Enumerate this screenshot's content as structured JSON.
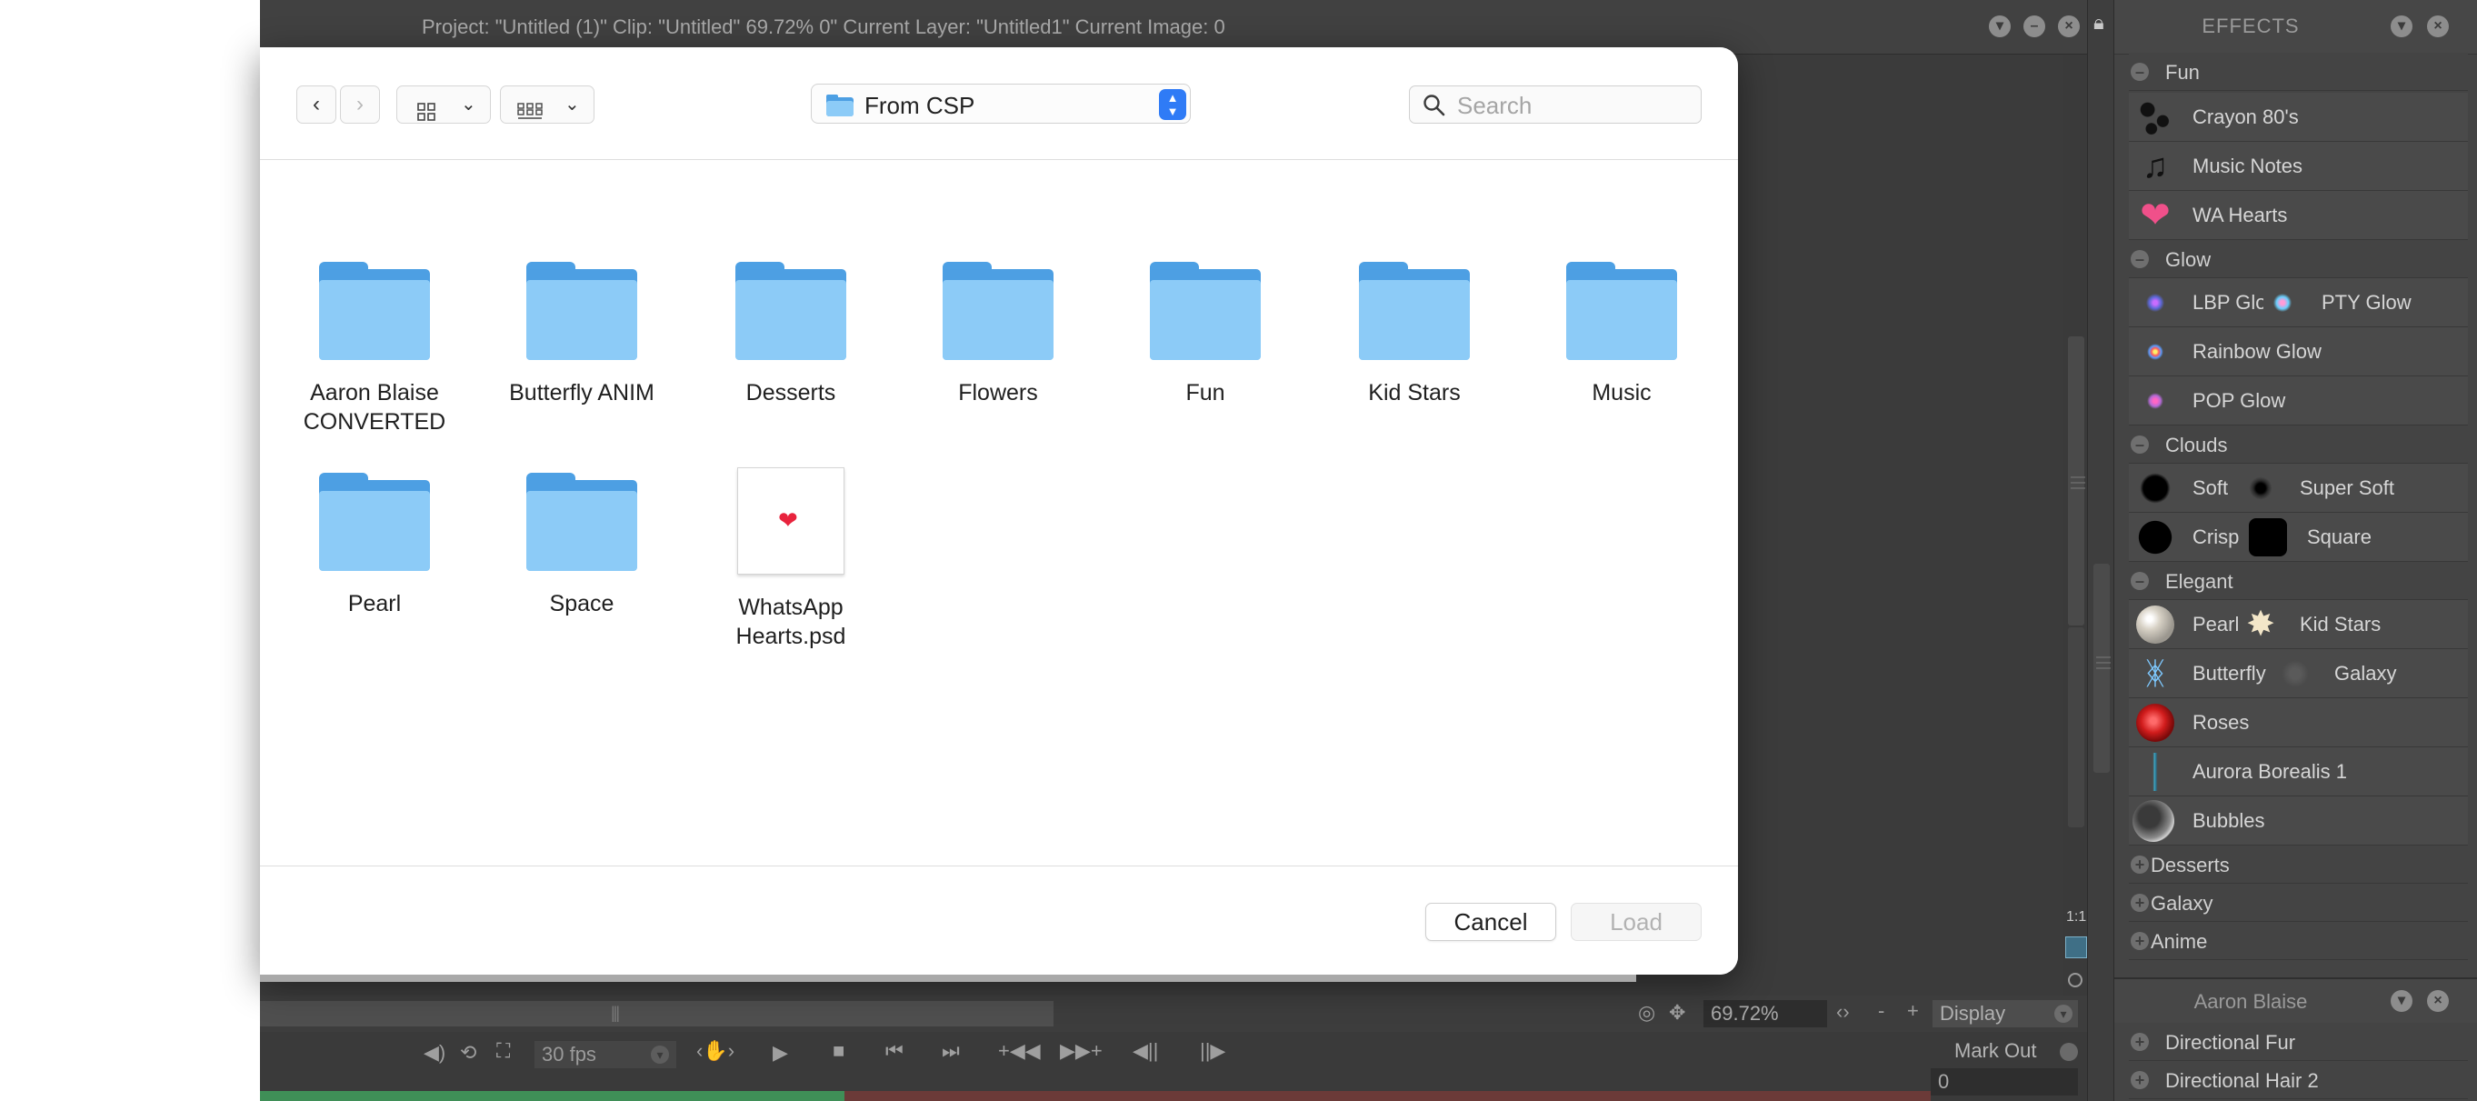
{
  "app": {
    "title_info": "Project:  \"Untitled (1)\"  Clip: \"Untitled\"   69.72%   0\"   Current Layer: \"Untitled1\"  Current Image: 0",
    "zoom": "69.72%",
    "display_label": "Display",
    "fps": "30 fps",
    "mark_out_label": "Mark Out",
    "frame": "0",
    "timeline_played_fraction": 0.35
  },
  "effects": {
    "title": "EFFECTS",
    "groups": [
      {
        "label": "Fun",
        "expanded": true,
        "items": [
          [
            "Crayon 80's"
          ],
          [
            "Music Notes"
          ],
          [
            "WA Hearts"
          ]
        ]
      },
      {
        "label": "Glow",
        "expanded": true,
        "items": [
          [
            "LBP Glow",
            "PTY Glow"
          ],
          [
            "Rainbow Glow"
          ],
          [
            "POP Glow"
          ]
        ]
      },
      {
        "label": "Clouds",
        "expanded": true,
        "items": [
          [
            "Soft",
            "Super Soft"
          ],
          [
            "Crisp",
            "Square"
          ]
        ]
      },
      {
        "label": "Elegant",
        "expanded": true,
        "items": [
          [
            "Pearl",
            "Kid Stars"
          ],
          [
            "Butterfly",
            "Galaxy"
          ],
          [
            "Roses"
          ],
          [
            "Aurora Borealis 1"
          ],
          [
            "Bubbles"
          ]
        ]
      },
      {
        "label": "Desserts",
        "expanded": false,
        "items": []
      },
      {
        "label": "Galaxy",
        "expanded": false,
        "items": []
      },
      {
        "label": "Anime",
        "expanded": false,
        "items": []
      }
    ]
  },
  "aaron_panel": {
    "title": "Aaron Blaise",
    "items": [
      "Directional Fur",
      "Directional Hair 2"
    ]
  },
  "dialog": {
    "location": "From CSP",
    "search_placeholder": "Search",
    "files": [
      {
        "name": "Aaron Blaise CONVERTED",
        "kind": "folder"
      },
      {
        "name": "Butterfly ANIM",
        "kind": "folder"
      },
      {
        "name": "Desserts",
        "kind": "folder"
      },
      {
        "name": "Flowers",
        "kind": "folder"
      },
      {
        "name": "Fun",
        "kind": "folder"
      },
      {
        "name": "Kid Stars",
        "kind": "folder"
      },
      {
        "name": "Music",
        "kind": "folder"
      },
      {
        "name": "Pearl",
        "kind": "folder"
      },
      {
        "name": "Space",
        "kind": "folder"
      },
      {
        "name": "WhatsApp Hearts.psd",
        "kind": "psd"
      }
    ],
    "cancel_label": "Cancel",
    "load_label": "Load"
  }
}
